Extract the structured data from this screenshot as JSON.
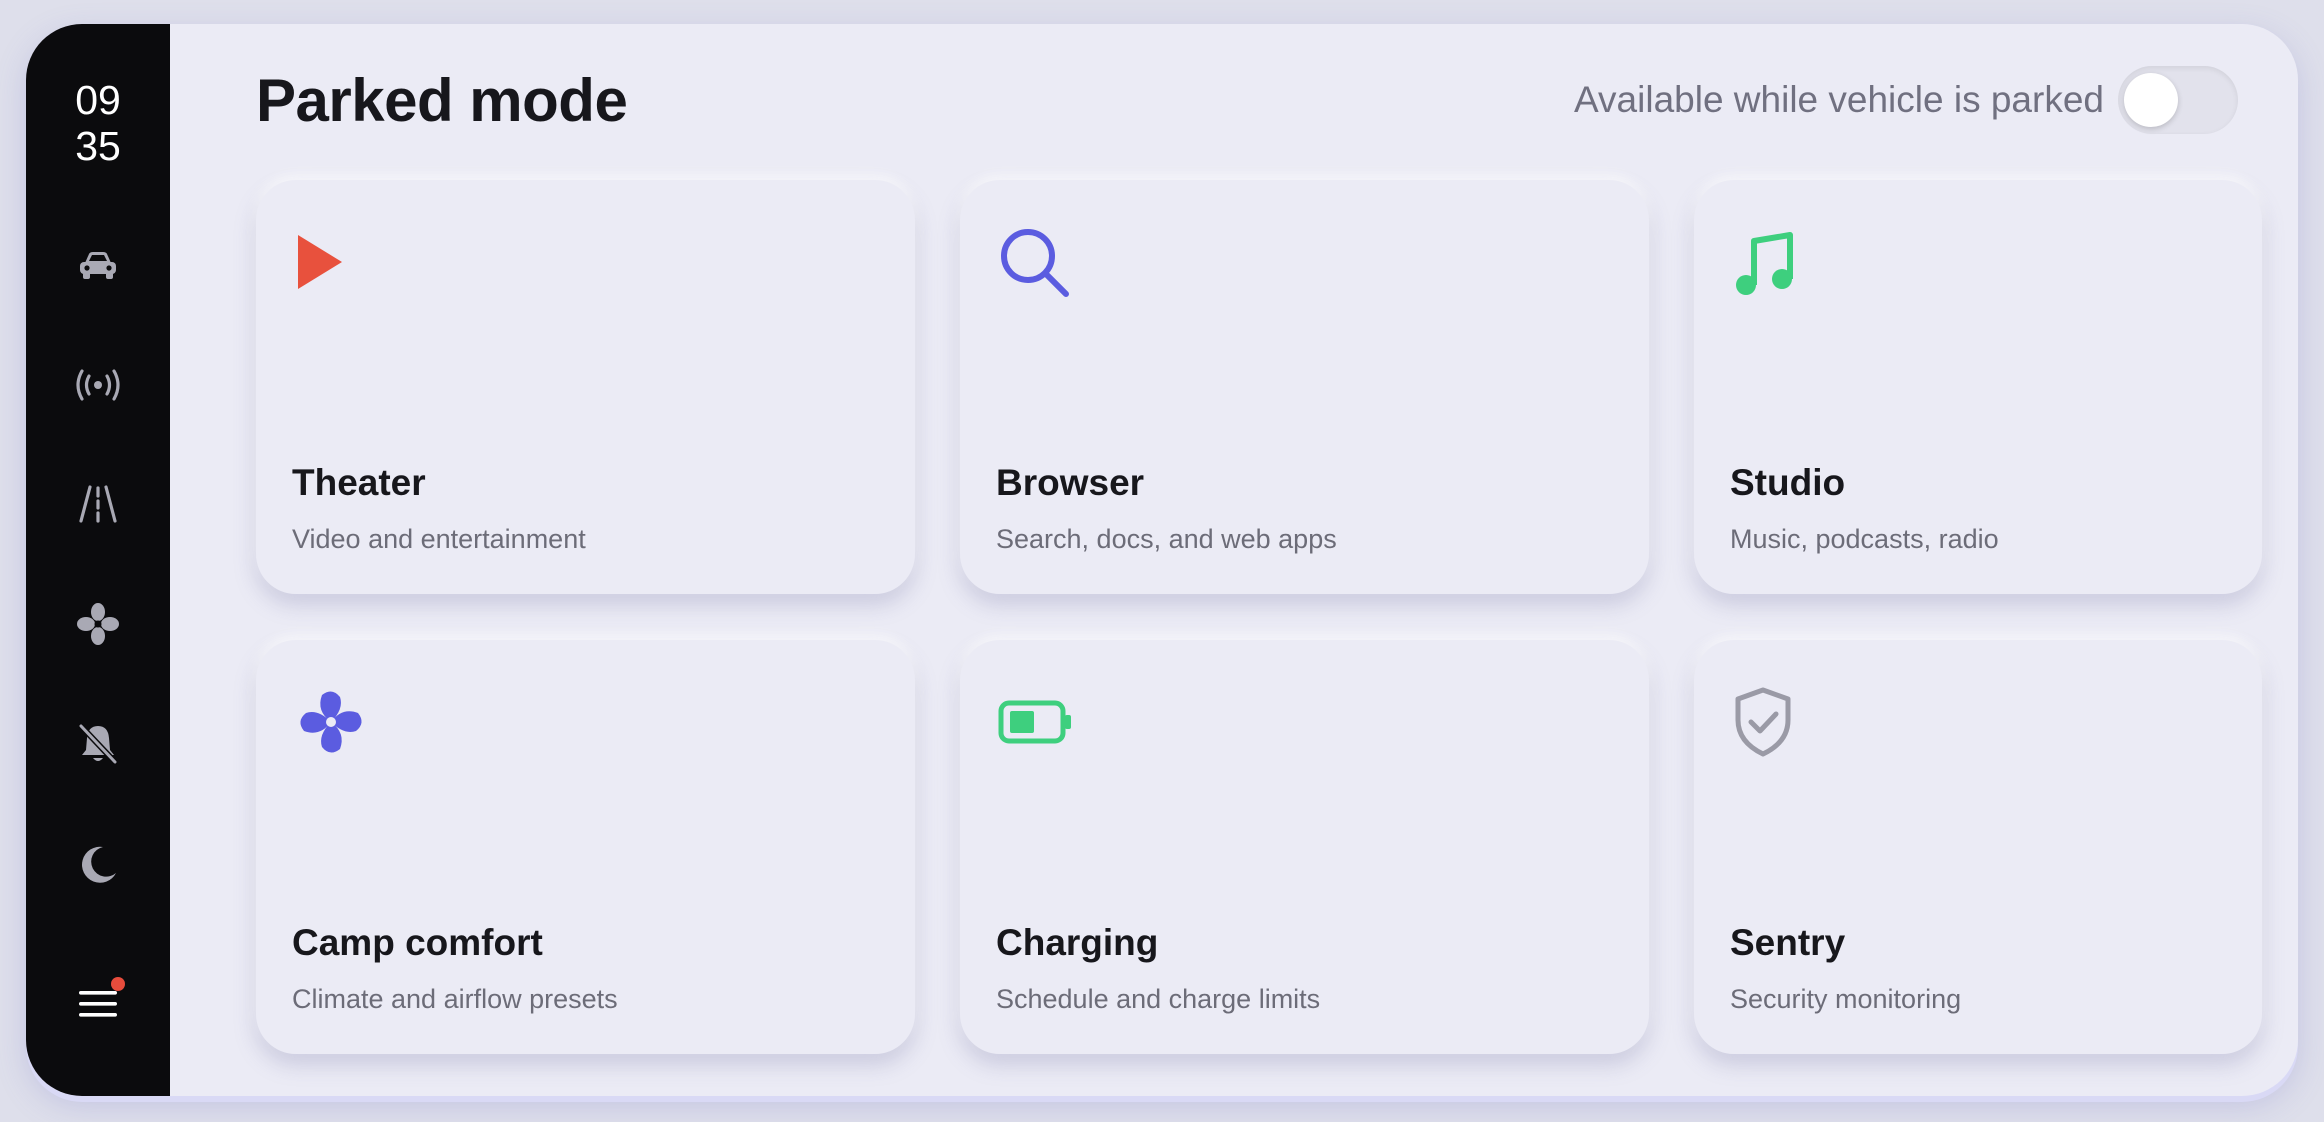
{
  "clock": {
    "hours": "09",
    "minutes": "35"
  },
  "header": {
    "title": "Parked mode",
    "availability_label": "Available while vehicle is parked",
    "availability_toggle_on": false
  },
  "sidebar": {
    "items": [
      {
        "icon": "car-icon"
      },
      {
        "icon": "broadcast-icon"
      },
      {
        "icon": "road-icon"
      },
      {
        "icon": "fan-icon"
      },
      {
        "icon": "bell-off-icon"
      },
      {
        "icon": "moon-icon"
      },
      {
        "icon": "menu-icon",
        "has_notification": true
      }
    ]
  },
  "cards": [
    {
      "title": "Theater",
      "subtitle": "Video and entertainment",
      "icon": "play-icon",
      "icon_color": "#e8513d"
    },
    {
      "title": "Browser",
      "subtitle": "Search, docs, and web apps",
      "icon": "search-icon",
      "icon_color": "#5b5ce0"
    },
    {
      "title": "Studio",
      "subtitle": "Music, podcasts, radio",
      "icon": "music-note-icon",
      "icon_color": "#3ecf7e"
    },
    {
      "title": "Camp comfort",
      "subtitle": "Climate and airflow presets",
      "icon": "fan-icon",
      "icon_color": "#5b5ce0"
    },
    {
      "title": "Charging",
      "subtitle": "Schedule and charge limits",
      "icon": "battery-icon",
      "icon_color": "#3ecf7e"
    },
    {
      "title": "Sentry",
      "subtitle": "Security monitoring",
      "icon": "shield-check-icon",
      "icon_color": "#9a9aa6"
    }
  ],
  "colors": {
    "rail_bg": "#0b0b0d",
    "surface": "#ebebf5",
    "notification_dot": "#e74c3c",
    "sidebar_icon": "#a9a9b4"
  }
}
